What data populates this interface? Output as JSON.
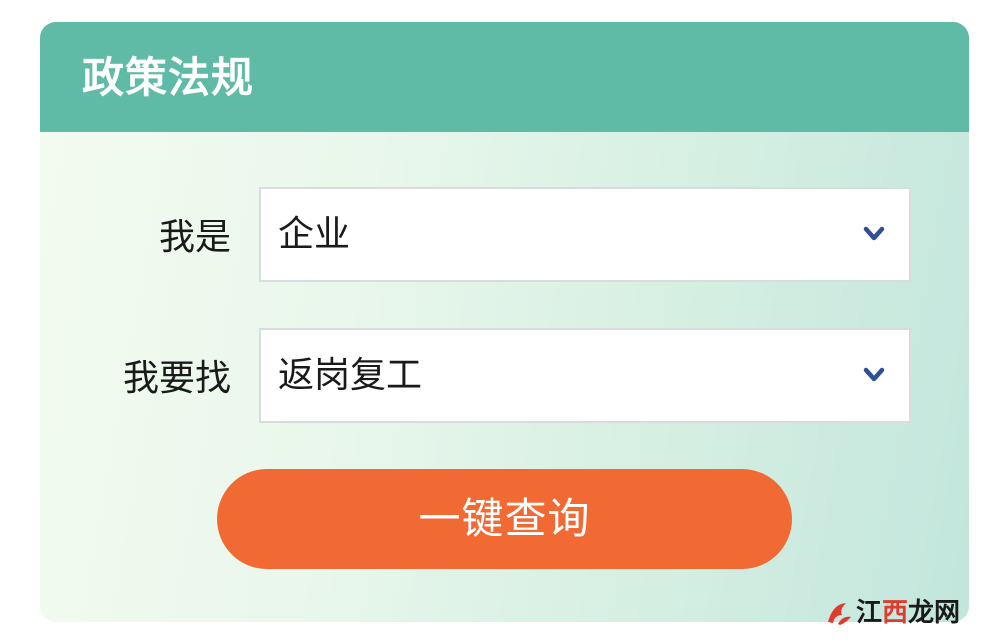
{
  "panel": {
    "title": "政策法规"
  },
  "form": {
    "identity": {
      "label": "我是",
      "selected": "企业"
    },
    "seeking": {
      "label": "我要找",
      "selected": "返岗复工"
    },
    "submit_label": "一键查询"
  },
  "watermark": {
    "part1": "江",
    "part2": "西",
    "part3": "龙网"
  },
  "colors": {
    "header": "#5fbba5",
    "button": "#f26a33",
    "chevron": "#2e4d9c"
  }
}
